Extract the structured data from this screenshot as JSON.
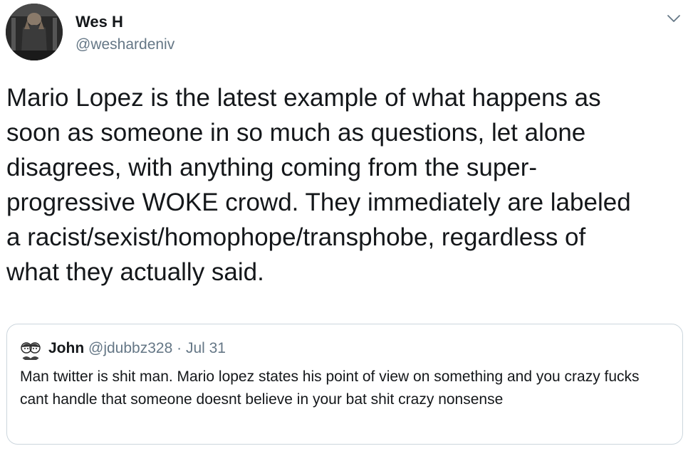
{
  "author": {
    "display_name": "Wes H",
    "handle": "@weshardeniv",
    "avatar_icon": "user-avatar-icon"
  },
  "tweet": {
    "text": "Mario Lopez is the latest example of what happens as\nsoon as someone in so much as questions, let alone\ndisagrees, with anything coming from the super-\nprogressive WOKE crowd. They immediately are labeled\na racist/sexist/homophope/transphobe, regardless of\nwhat they actually said."
  },
  "menu": {
    "icon": "chevron-down-icon"
  },
  "quoted_tweet": {
    "display_name": "John",
    "handle": "@jdubbz328",
    "separator": " · ",
    "date": "Jul 31",
    "text": "Man twitter is shit man. Mario lopez states his point of view on something and you crazy fucks cant handle that someone doesnt believe in your bat shit crazy nonsense",
    "avatar_icon": "user-avatar-icon"
  },
  "colors": {
    "text_primary": "#14171a",
    "text_secondary": "#657786",
    "border": "#ccd6dd"
  }
}
